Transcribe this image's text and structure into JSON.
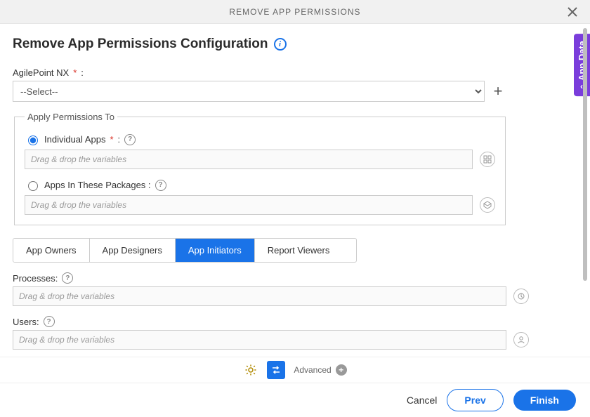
{
  "header": {
    "title": "REMOVE APP PERMISSIONS"
  },
  "page": {
    "title": "Remove App Permissions Configuration"
  },
  "agilepoint": {
    "label": "AgilePoint NX",
    "selected": "--Select--"
  },
  "permissions": {
    "legend": "Apply Permissions To",
    "individual": {
      "label": "Individual Apps",
      "placeholder": "Drag & drop the variables"
    },
    "packages": {
      "label": "Apps In These Packages :",
      "placeholder": "Drag & drop the variables"
    }
  },
  "tabs": [
    {
      "label": "App Owners",
      "active": false
    },
    {
      "label": "App Designers",
      "active": false
    },
    {
      "label": "App Initiators",
      "active": true
    },
    {
      "label": "Report Viewers",
      "active": false
    }
  ],
  "processes": {
    "label": "Processes:",
    "placeholder": "Drag & drop the variables"
  },
  "users": {
    "label": "Users:",
    "placeholder": "Drag & drop the variables"
  },
  "advanced": {
    "label": "Advanced"
  },
  "side": {
    "label": "App Data"
  },
  "footer": {
    "cancel": "Cancel",
    "prev": "Prev",
    "finish": "Finish"
  }
}
